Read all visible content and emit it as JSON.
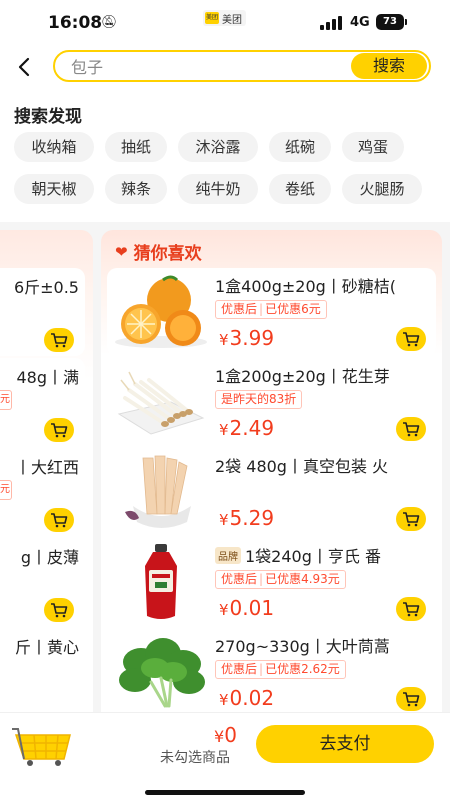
{
  "status": {
    "time": "16:08",
    "app": "美团",
    "network": "4G",
    "battery": "73"
  },
  "search": {
    "placeholder": "包子",
    "button": "搜索"
  },
  "discover": {
    "title": "搜索发现",
    "chips": [
      "收纳箱",
      "抽纸",
      "沐浴露",
      "纸碗",
      "鸡蛋",
      "朝天椒",
      "辣条",
      "纯牛奶",
      "卷纸",
      "火腿肠"
    ]
  },
  "left_cards": [
    {
      "title": "6斤±0.5",
      "badge": ""
    },
    {
      "title": "48g丨满",
      "badge": "元"
    },
    {
      "title": "丨大红西",
      "badge": "元"
    },
    {
      "title": "g丨皮薄",
      "badge": ""
    },
    {
      "title": "斤丨黄心",
      "badge": ""
    }
  ],
  "guess": {
    "title": "猜你喜欢",
    "products": [
      {
        "title": "1盒400g±20g丨砂糖桔(",
        "brand": "",
        "tag1": "优惠后",
        "tag2": "已优惠6元",
        "price_sym": "¥",
        "price": "3.99",
        "image": "orange"
      },
      {
        "title": "1盒200g±20g丨花生芽",
        "brand": "",
        "tag1": "是昨天的83折",
        "tag2": "",
        "price_sym": "¥",
        "price": "2.49",
        "image": "sprouts"
      },
      {
        "title": "2袋 480g丨真空包装 火",
        "brand": "",
        "tag1": "",
        "tag2": "",
        "price_sym": "¥",
        "price": "5.29",
        "image": "bamboo"
      },
      {
        "title": "1袋240g丨亨氏 番",
        "brand": "品牌",
        "tag1": "优惠后",
        "tag2": "已优惠4.93元",
        "price_sym": "¥",
        "price": "0.01",
        "image": "ketchup"
      },
      {
        "title": "270g~330g丨大叶茼蒿",
        "brand": "",
        "tag1": "优惠后",
        "tag2": "已优惠2.62元",
        "price_sym": "¥",
        "price": "0.02",
        "image": "greens"
      }
    ]
  },
  "bottom": {
    "total_sym": "¥",
    "total": "0",
    "unselected": "未勾选商品",
    "pay": "去支付"
  },
  "colors": {
    "accent": "#ffd100",
    "price": "#f23c1d",
    "title_red": "#e83e1d"
  }
}
